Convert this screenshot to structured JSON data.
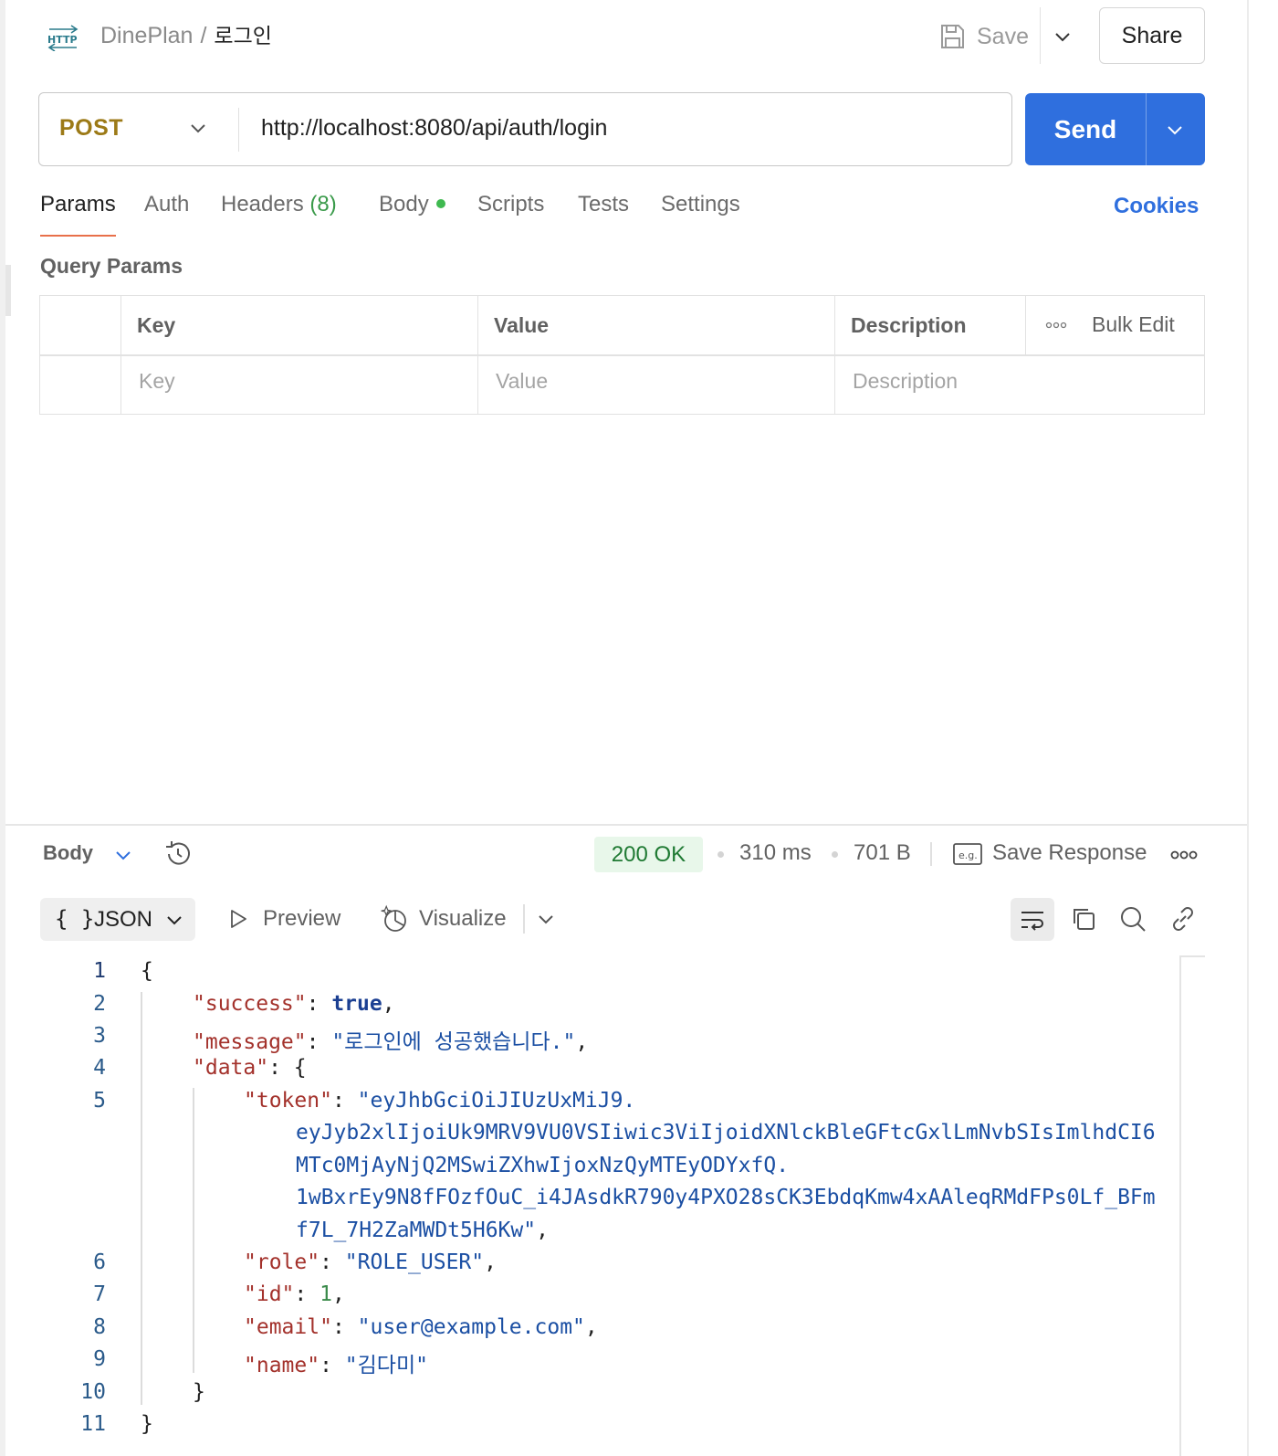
{
  "header": {
    "collection": "DinePlan",
    "separator": "/",
    "request_name": "로그인",
    "save_label": "Save",
    "share_label": "Share"
  },
  "request": {
    "method": "POST",
    "url": "http://localhost:8080/api/auth/login",
    "send_label": "Send",
    "method_color": "#9c7a17",
    "send_color": "#2f6fde"
  },
  "tabs": {
    "params": "Params",
    "auth": "Auth",
    "headers": "Headers",
    "headers_count": "(8)",
    "body": "Body",
    "scripts": "Scripts",
    "tests": "Tests",
    "settings": "Settings",
    "cookies": "Cookies",
    "active": "Params"
  },
  "query_params": {
    "title": "Query Params",
    "columns": [
      "Key",
      "Value",
      "Description"
    ],
    "bulk_edit": "Bulk Edit",
    "placeholders": {
      "key": "Key",
      "value": "Value",
      "description": "Description"
    }
  },
  "response": {
    "view_label": "Body",
    "status": "200 OK",
    "time": "310 ms",
    "size": "701 B",
    "save_response": "Save Response",
    "format": "JSON",
    "format_icon": "{ }",
    "preview": "Preview",
    "visualize": "Visualize",
    "status_color": "#1f7a33"
  },
  "code": {
    "line_numbers": [
      "1",
      "2",
      "3",
      "4",
      "5",
      "6",
      "7",
      "8",
      "9",
      "10",
      "11"
    ],
    "open_brace": "{",
    "close_brace": "}",
    "success_key": "\"success\"",
    "success_value": "true",
    "message_key": "\"message\"",
    "message_value": "\"로그인에 성공했습니다.\"",
    "data_key": "\"data\"",
    "token_key": "\"token\"",
    "token_value_lines": [
      "\"eyJhbGciOiJIUzUxMiJ9.",
      "eyJyb2xlIjoiUk9MRV9VU0VSIiwic3ViIjoidXNlckBleGFtcGxlLmNvbSIsImlhdCI6",
      "MTc0MjAyNjQ2MSwiZXhwIjoxNzQyMTEyODYxfQ.",
      "1wBxrEy9N8fFOzfOuC_i4JAsdkR790y4PXO28sCK3EbdqKmw4xAAleqRMdFPs0Lf_BFm",
      "f7L_7H2ZaMWDt5H6Kw\""
    ],
    "role_key": "\"role\"",
    "role_value": "\"ROLE_USER\"",
    "id_key": "\"id\"",
    "id_value": "1",
    "email_key": "\"email\"",
    "email_value": "\"user@example.com\"",
    "name_key": "\"name\"",
    "name_value": "\"김다미\""
  }
}
